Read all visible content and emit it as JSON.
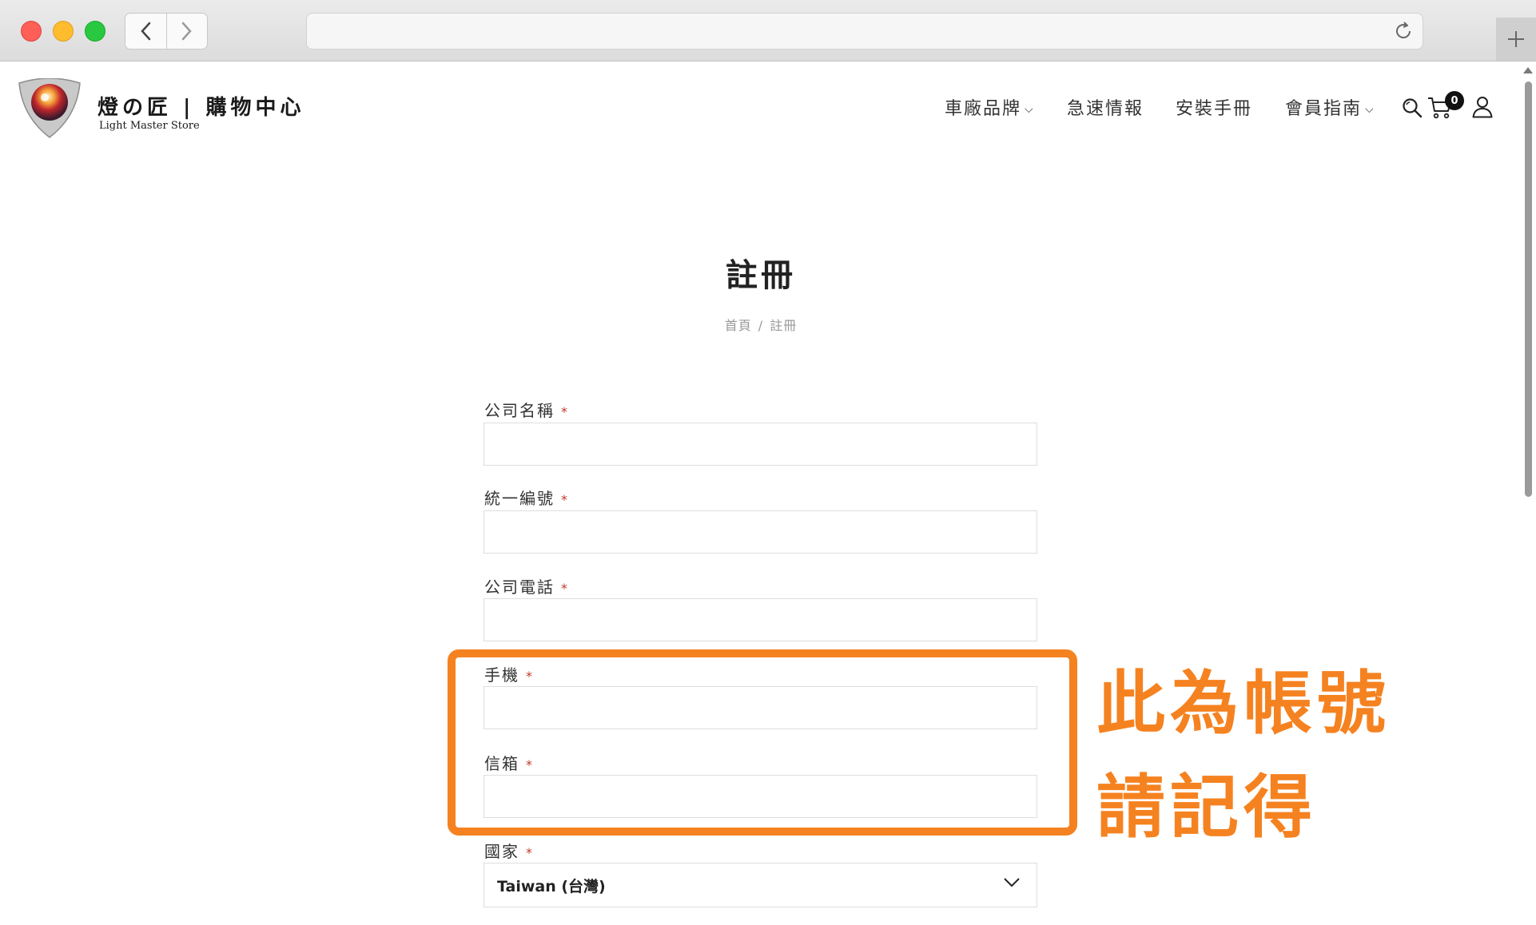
{
  "browser": {
    "url": ""
  },
  "site": {
    "logo_title": "燈の匠 | 購物中心",
    "logo_subtitle": "Light Master Store",
    "nav": [
      {
        "label": "車廠品牌",
        "has_dropdown": true
      },
      {
        "label": "急速情報",
        "has_dropdown": false
      },
      {
        "label": "安裝手冊",
        "has_dropdown": false
      },
      {
        "label": "會員指南",
        "has_dropdown": true
      }
    ],
    "cart_count": "0",
    "icons": [
      "search-icon",
      "cart-icon",
      "user-icon"
    ]
  },
  "page": {
    "title": "註冊",
    "breadcrumb": {
      "home": "首頁",
      "separator": "/",
      "current": "註冊"
    }
  },
  "form": {
    "required_mark": "*",
    "fields": [
      {
        "label": "公司名稱",
        "value": ""
      },
      {
        "label": "統一編號",
        "value": ""
      },
      {
        "label": "公司電話",
        "value": ""
      },
      {
        "label": "手機",
        "value": ""
      },
      {
        "label": "信箱",
        "value": ""
      },
      {
        "label": "國家",
        "value": "Taiwan (台灣)"
      }
    ]
  },
  "annotation": {
    "line1": "此為帳號",
    "line2": "請記得",
    "color": "#f58220"
  },
  "colors": {
    "required": "#c0392b",
    "annotation": "#f58220"
  }
}
